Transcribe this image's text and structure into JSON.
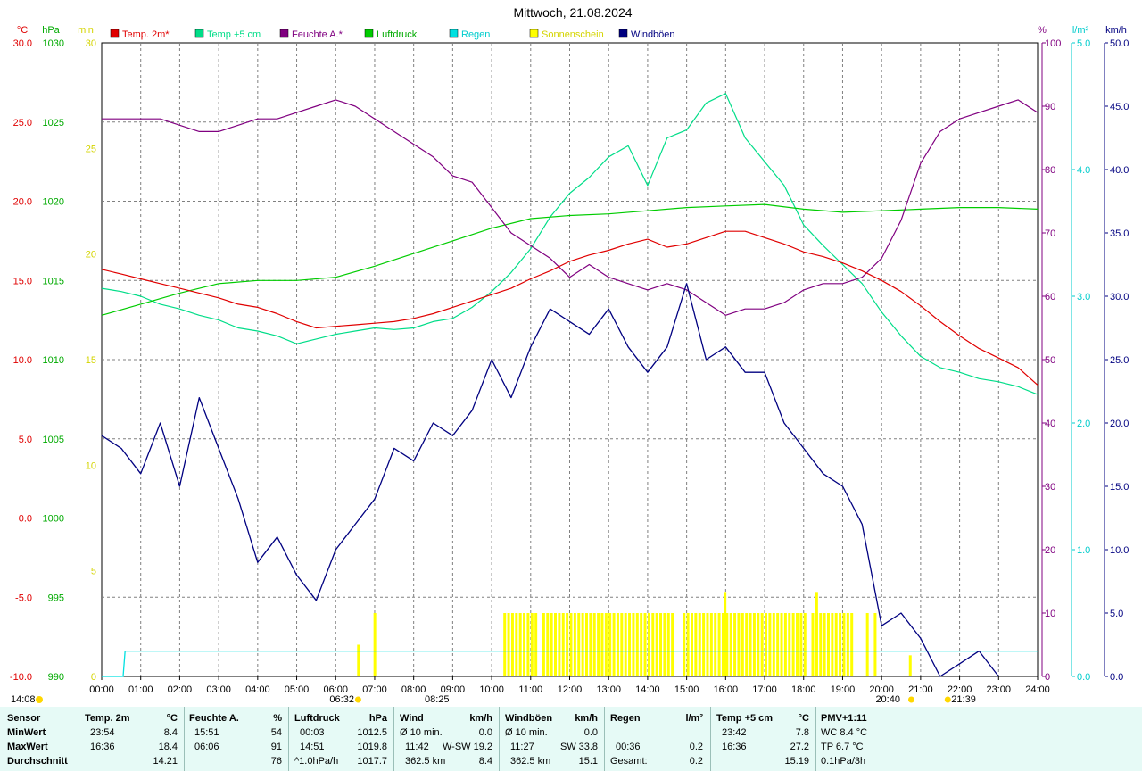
{
  "title": "Mittwoch, 21.08.2024",
  "colors": {
    "temp2m": "#e00000",
    "temp5cm": "#00dd88",
    "humidity": "#800080",
    "pressure": "#00cc00",
    "rain": "#00e0e0",
    "sunshine": "#ffff00",
    "gust": "#000080",
    "grid": "#808080"
  },
  "legend": [
    {
      "label": "Temp. 2m*",
      "color": "#e00000"
    },
    {
      "label": "Temp +5 cm",
      "color": "#00dd88"
    },
    {
      "label": "Feuchte A.*",
      "color": "#800080"
    },
    {
      "label": "Luftdruck",
      "color": "#00cc00"
    },
    {
      "label": "Regen",
      "color": "#00e0e0"
    },
    {
      "label": "Sonnenschein",
      "color": "#ffff00"
    },
    {
      "label": "Windböen",
      "color": "#000080"
    }
  ],
  "axes": {
    "temp_unit": "°C",
    "pressure_unit": "hPa",
    "sun_unit": "min",
    "hum_unit": "%",
    "rain_unit": "l/m²",
    "wind_unit": "km/h",
    "temp_ticks": [
      "30.0",
      "25.0",
      "20.0",
      "15.0",
      "10.0",
      "5.0",
      "0.0",
      "-5.0",
      "-10.0"
    ],
    "pressure_ticks": [
      "1030",
      "1025",
      "1020",
      "1015",
      "1010",
      "1005",
      "1000",
      "995",
      "990"
    ],
    "sun_ticks": [
      "30",
      "25",
      "20",
      "15",
      "10",
      "5",
      "0"
    ],
    "hum_ticks": [
      "100",
      "90",
      "80",
      "70",
      "60",
      "50",
      "40",
      "30",
      "20",
      "10",
      "0"
    ],
    "rain_ticks": [
      "5.0",
      "4.0",
      "3.0",
      "2.0",
      "1.0",
      "0.0"
    ],
    "wind_ticks": [
      "50.0",
      "45.0",
      "40.0",
      "35.0",
      "30.0",
      "25.0",
      "20.0",
      "15.0",
      "10.0",
      "5.0",
      "0.0"
    ],
    "x_ticks": [
      "00:00",
      "01:00",
      "02:00",
      "03:00",
      "04:00",
      "05:00",
      "06:00",
      "07:00",
      "08:00",
      "09:00",
      "10:00",
      "11:00",
      "12:00",
      "13:00",
      "14:00",
      "15:00",
      "16:00",
      "17:00",
      "18:00",
      "19:00",
      "20:00",
      "21:00",
      "22:00",
      "23:00",
      "24:00"
    ]
  },
  "markers": {
    "moonset": "14:08",
    "sunrise": "06:32",
    "moonrise_label": "08:25",
    "sunset": "20:40",
    "moonrise2": "21:39"
  },
  "chart_data": {
    "type": "line",
    "x_label": "",
    "xlim": [
      0,
      24
    ],
    "series": [
      {
        "name": "Temp. 2m*",
        "unit": "°C",
        "ylim": [
          -10,
          30
        ],
        "x": [
          0,
          0.5,
          1,
          1.5,
          2,
          2.5,
          3,
          3.5,
          4,
          4.5,
          5,
          5.5,
          6,
          6.5,
          7,
          7.5,
          8,
          8.5,
          9,
          9.5,
          10,
          10.5,
          11,
          11.5,
          12,
          12.5,
          13,
          13.5,
          14,
          14.5,
          15,
          15.5,
          16,
          16.5,
          17,
          17.5,
          18,
          18.5,
          19,
          19.5,
          20,
          20.5,
          21,
          21.5,
          22,
          22.5,
          23,
          23.5,
          24
        ],
        "y": [
          15.7,
          15.4,
          15.1,
          14.8,
          14.5,
          14.2,
          13.9,
          13.5,
          13.3,
          12.9,
          12.4,
          12.0,
          12.1,
          12.2,
          12.3,
          12.4,
          12.6,
          12.9,
          13.3,
          13.7,
          14.1,
          14.5,
          15.1,
          15.6,
          16.2,
          16.6,
          16.9,
          17.3,
          17.6,
          17.1,
          17.3,
          17.7,
          18.1,
          18.1,
          17.7,
          17.3,
          16.8,
          16.5,
          16.1,
          15.6,
          15.0,
          14.3,
          13.4,
          12.4,
          11.5,
          10.7,
          10.1,
          9.5,
          8.4
        ]
      },
      {
        "name": "Temp +5 cm",
        "unit": "°C",
        "ylim": [
          -10,
          30
        ],
        "x": [
          0,
          0.5,
          1,
          1.5,
          2,
          2.5,
          3,
          3.5,
          4,
          4.5,
          5,
          5.5,
          6,
          6.5,
          7,
          7.5,
          8,
          8.5,
          9,
          9.5,
          10,
          10.5,
          11,
          11.5,
          12,
          12.5,
          13,
          13.5,
          14,
          14.5,
          15,
          15.5,
          16,
          16.5,
          17,
          17.5,
          18,
          18.5,
          19,
          19.5,
          20,
          20.5,
          21,
          21.5,
          22,
          22.5,
          23,
          23.5,
          24
        ],
        "y": [
          14.5,
          14.3,
          14.0,
          13.5,
          13.2,
          12.8,
          12.5,
          12.0,
          11.8,
          11.5,
          11.0,
          11.3,
          11.6,
          11.8,
          12.0,
          11.9,
          12.0,
          12.4,
          12.6,
          13.3,
          14.3,
          15.5,
          17.0,
          19.0,
          20.5,
          21.5,
          22.8,
          23.5,
          21.0,
          24.0,
          24.5,
          26.2,
          26.8,
          24.0,
          22.5,
          21.0,
          18.5,
          17.2,
          16.0,
          14.8,
          13.0,
          11.5,
          10.2,
          9.5,
          9.2,
          8.8,
          8.6,
          8.3,
          7.8
        ]
      },
      {
        "name": "Feuchte A.*",
        "unit": "%",
        "ylim": [
          0,
          100
        ],
        "x": [
          0,
          0.5,
          1,
          1.5,
          2,
          2.5,
          3,
          3.5,
          4,
          4.5,
          5,
          5.5,
          6,
          6.5,
          7,
          7.5,
          8,
          8.5,
          9,
          9.5,
          10,
          10.5,
          11,
          11.5,
          12,
          12.5,
          13,
          13.5,
          14,
          14.5,
          15,
          15.5,
          16,
          16.5,
          17,
          17.5,
          18,
          18.5,
          19,
          19.5,
          20,
          20.5,
          21,
          21.5,
          22,
          22.5,
          23,
          23.5,
          24
        ],
        "y": [
          88,
          88,
          88,
          88,
          87,
          86,
          86,
          87,
          88,
          88,
          89,
          90,
          91,
          90,
          88,
          86,
          84,
          82,
          79,
          78,
          74,
          70,
          68,
          66,
          63,
          65,
          63,
          62,
          61,
          62,
          61,
          59,
          57,
          58,
          58,
          59,
          61,
          62,
          62,
          63,
          66,
          72,
          81,
          86,
          88,
          89,
          90,
          91,
          89
        ]
      },
      {
        "name": "Luftdruck",
        "unit": "hPa",
        "ylim": [
          990,
          1030
        ],
        "x": [
          0,
          1,
          2,
          3,
          4,
          5,
          6,
          7,
          8,
          9,
          10,
          11,
          12,
          13,
          14,
          15,
          16,
          17,
          18,
          19,
          20,
          21,
          22,
          23,
          24
        ],
        "y": [
          1012.8,
          1013.5,
          1014.2,
          1014.8,
          1015.0,
          1015.0,
          1015.2,
          1015.9,
          1016.7,
          1017.5,
          1018.3,
          1018.9,
          1019.1,
          1019.2,
          1019.4,
          1019.6,
          1019.7,
          1019.8,
          1019.5,
          1019.3,
          1019.4,
          1019.5,
          1019.6,
          1019.6,
          1019.5
        ]
      },
      {
        "name": "Regen",
        "unit": "l/m²",
        "ylim": [
          0,
          5
        ],
        "x": [
          0,
          0.55,
          0.6,
          24
        ],
        "y": [
          0,
          0,
          0.2,
          0.2
        ]
      },
      {
        "name": "Windböen",
        "unit": "km/h",
        "ylim": [
          0,
          50
        ],
        "x": [
          0,
          0.5,
          1,
          1.5,
          2,
          2.5,
          3,
          3.5,
          4,
          4.5,
          5,
          5.5,
          6,
          6.5,
          7,
          7.5,
          8,
          8.5,
          9,
          9.5,
          10,
          10.5,
          11,
          11.5,
          12,
          12.5,
          13,
          13.5,
          14,
          14.5,
          15,
          15.5,
          16,
          16.5,
          17,
          17.5,
          18,
          18.5,
          19,
          19.5,
          20,
          20.5,
          21,
          21.5,
          22,
          22.5,
          23
        ],
        "y": [
          19,
          18,
          16,
          20,
          15,
          22,
          18,
          14,
          9,
          11,
          8,
          6,
          10,
          12,
          14,
          18,
          17,
          20,
          19,
          21,
          25,
          22,
          26,
          29,
          28,
          27,
          29,
          26,
          24,
          26,
          31,
          25,
          26,
          24,
          24,
          20,
          18,
          16,
          15,
          12,
          4,
          5,
          3,
          0,
          1,
          2,
          0
        ]
      },
      {
        "name": "Sonnenschein",
        "unit": "min",
        "ylim": [
          0,
          30
        ],
        "x": [
          6.5,
          7.0,
          10.3,
          10.6,
          11.0,
          12.0,
          13.0,
          14.0,
          14.9,
          15.5,
          16.0,
          16.5,
          17.0,
          17.5,
          18.0,
          18.5,
          19.0,
          19.3
        ],
        "y": [
          2,
          3,
          3,
          3,
          3,
          3,
          3,
          3,
          3,
          3,
          3,
          3,
          3,
          3,
          3,
          3,
          3,
          2
        ]
      }
    ]
  },
  "stats": {
    "sensor": {
      "header": "Sensor",
      "rows": [
        "MinWert",
        "MaxWert",
        "Durchschnitt"
      ]
    },
    "temp2m": {
      "header": "Temp. 2m",
      "unit": "°C",
      "min_time": "23:54",
      "min": "8.4",
      "max_time": "16:36",
      "max": "18.4",
      "avg": "14.21"
    },
    "humidity": {
      "header": "Feuchte A.",
      "unit": "%",
      "min_time": "15:51",
      "min": "54",
      "max_time": "06:06",
      "max": "91",
      "avg": "76"
    },
    "pressure": {
      "header": "Luftdruck",
      "unit": "hPa",
      "min_time": "00:03",
      "min": "1012.5",
      "max_time": "14:51",
      "max": "1019.8",
      "trend": "^1.0hPa/h",
      "avg": "1017.7"
    },
    "wind": {
      "header": "Wind",
      "unit": "km/h",
      "row1_label": "Ø 10 min.",
      "row1_val": "0.0",
      "max_time": "11:42",
      "max_dir": "W-SW",
      "max": "19.2",
      "dist": "362.5 km",
      "avg": "8.4"
    },
    "gust": {
      "header": "Windböen",
      "unit": "km/h",
      "row1_label": "Ø 10 min.",
      "row1_val": "0.0",
      "max_time": "11:27",
      "max_dir": "SW",
      "max": "33.8",
      "dist": "362.5 km",
      "avg": "15.1"
    },
    "rain": {
      "header": "Regen",
      "unit": "l/m²",
      "max_time": "00:36",
      "max": "0.2",
      "total_label": "Gesamt:",
      "total": "0.2"
    },
    "temp5cm": {
      "header": "Temp +5 cm",
      "unit": "°C",
      "min_time": "23:42",
      "min": "7.8",
      "max_time": "16:36",
      "max": "27.2",
      "avg": "15.19"
    },
    "pmv": {
      "header": "PMV+1:11",
      "wc": "WC 8.4 °C",
      "tp": "TP 6.7 °C",
      "trend": "0.1hPa/3h"
    }
  }
}
